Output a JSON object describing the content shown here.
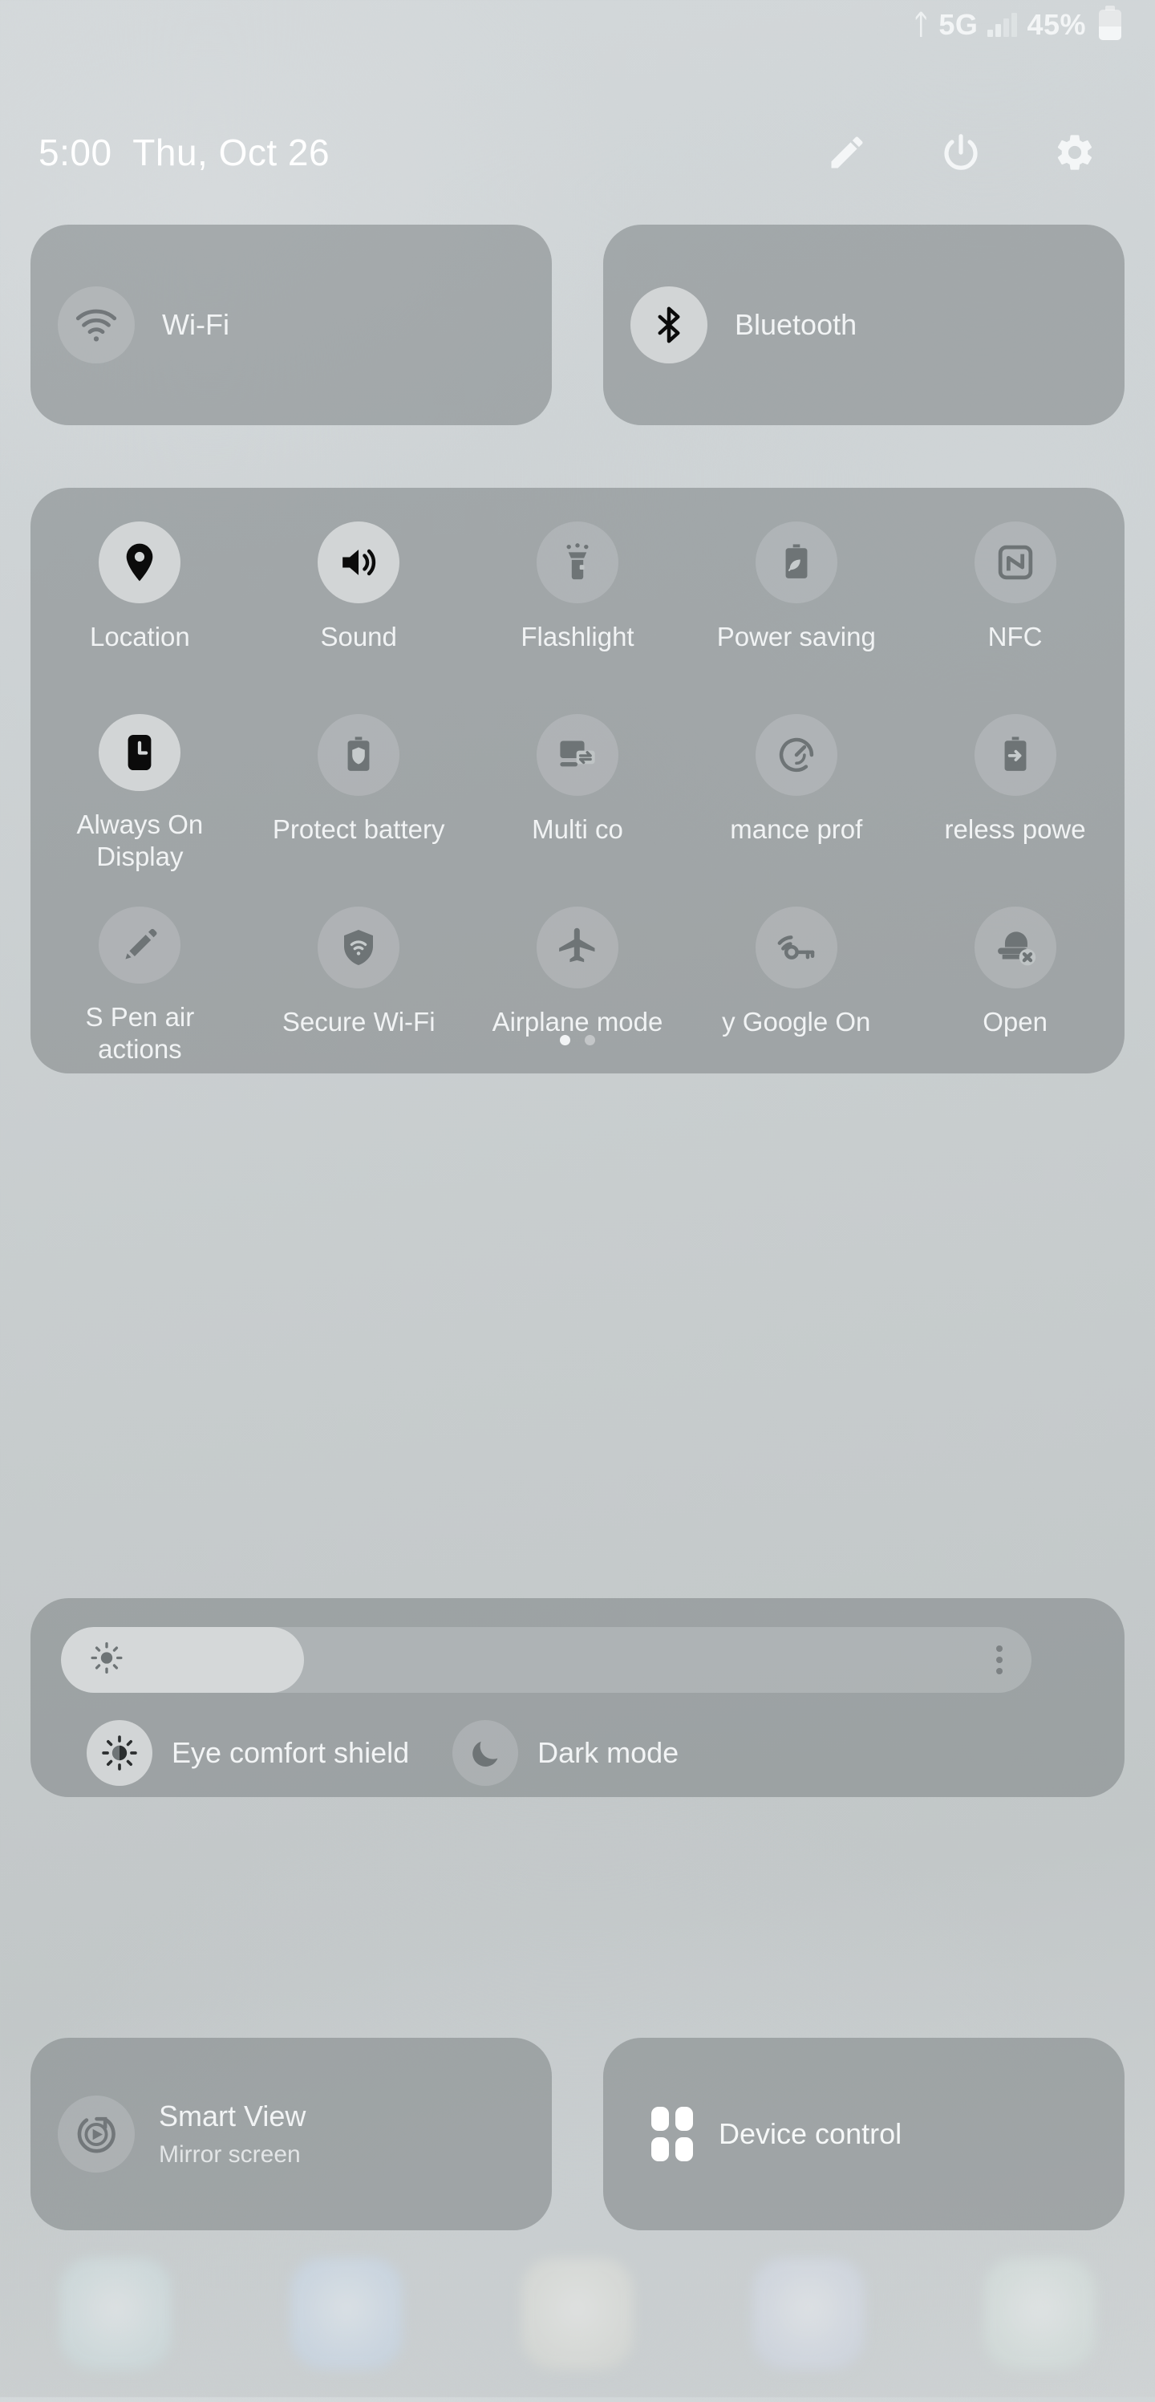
{
  "status_bar": {
    "bluetooth_icon": "bluetooth-icon",
    "network_type": "5G",
    "signal_icon": "signal-bars-icon",
    "battery_percent": "45%",
    "battery_icon": "battery-icon"
  },
  "header": {
    "time": "5:00",
    "date": "Thu, Oct 26",
    "clock_line": "5:00  Thu, Oct 26",
    "buttons": [
      {
        "name": "edit-button",
        "icon": "pencil-icon"
      },
      {
        "name": "power-button",
        "icon": "power-icon"
      },
      {
        "name": "settings-button",
        "icon": "gear-icon"
      }
    ]
  },
  "top_toggles": [
    {
      "label": "Wi-Fi",
      "icon": "wifi-icon",
      "state": "off"
    },
    {
      "label": "Bluetooth",
      "icon": "bluetooth-icon",
      "state": "on"
    }
  ],
  "quick_tiles": {
    "rows": [
      [
        {
          "label": "Location",
          "icon": "location-pin-icon",
          "state": "on"
        },
        {
          "label": "Sound",
          "icon": "speaker-icon",
          "state": "on"
        },
        {
          "label": "Flashlight",
          "icon": "flashlight-icon",
          "state": "off"
        },
        {
          "label": "Power saving",
          "icon": "battery-leaf-icon",
          "state": "off"
        },
        {
          "label": "NFC",
          "icon": "nfc-icon",
          "state": "off"
        }
      ],
      [
        {
          "label": "Always On Display",
          "icon": "aod-clock-icon",
          "state": "on"
        },
        {
          "label": "Protect battery",
          "icon": "battery-shield-icon",
          "state": "off"
        },
        {
          "label": "Multi co",
          "icon": "multi-control-icon",
          "state": "off"
        },
        {
          "label": "mance prof",
          "icon": "performance-profile-icon",
          "state": "off"
        },
        {
          "label": "reless powe",
          "icon": "wireless-power-share-icon",
          "state": "off"
        }
      ],
      [
        {
          "label": "S Pen air actions",
          "icon": "s-pen-icon",
          "state": "off"
        },
        {
          "label": "Secure Wi-Fi",
          "icon": "shield-wifi-icon",
          "state": "off"
        },
        {
          "label": "Airplane mode",
          "icon": "airplane-icon",
          "state": "off"
        },
        {
          "label": "y Google On",
          "icon": "vpn-key-icon",
          "state": "off"
        },
        {
          "label": "Open",
          "icon": "blocked-cap-icon",
          "state": "off"
        }
      ]
    ],
    "page_indicator": {
      "total": 2,
      "current": 1
    }
  },
  "brightness": {
    "slider_name": "brightness-slider",
    "value_percent": 25,
    "sun_icon": "sun-icon",
    "more_options_icon": "more-vertical-icon"
  },
  "display_modes": [
    {
      "label": "Eye comfort shield",
      "icon": "eye-comfort-icon",
      "state": "on"
    },
    {
      "label": "Dark mode",
      "icon": "moon-icon",
      "state": "off"
    }
  ],
  "bottom_tiles": {
    "smart_view": {
      "title": "Smart View",
      "subtitle": "Mirror screen",
      "icon": "smart-view-icon"
    },
    "device_control": {
      "label": "Device control",
      "icon": "device-control-icon"
    }
  },
  "colors": {
    "card_bg": "#787E80",
    "tile_on": "#D2D5D6",
    "tile_off": "rgba(226,229,230,0.22)",
    "text": "#F2F4F5",
    "icon_on": "#0B0B0B",
    "icon_off": "#6E7476"
  }
}
